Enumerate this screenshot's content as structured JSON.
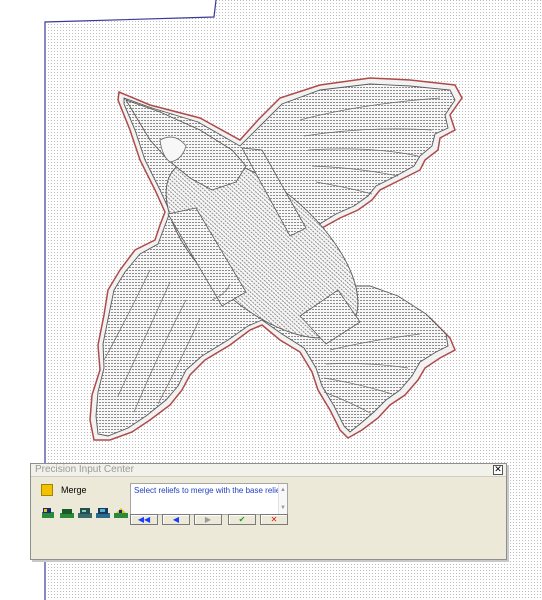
{
  "panel": {
    "title": "Precision Input Center",
    "close_glyph": "✕",
    "tool_name": "Merge",
    "tool_color": "#f2c200",
    "message": "Select reliefs to merge with the base relief",
    "toolbar_icons": [
      "relief-tool-1-icon",
      "relief-tool-2-icon",
      "relief-tool-3-icon",
      "relief-tool-4-icon",
      "relief-tool-5-icon"
    ],
    "nav_buttons": [
      {
        "name": "first-button",
        "glyph": "◀◀",
        "color": "#1a3cff"
      },
      {
        "name": "previous-button",
        "glyph": "◀",
        "color": "#1a3cff"
      },
      {
        "name": "next-button",
        "glyph": "▶",
        "color": "#9a9a9a"
      },
      {
        "name": "accept-button",
        "glyph": "✔",
        "color": "#1fa01f"
      },
      {
        "name": "cancel-button",
        "glyph": "✕",
        "color": "#e01010"
      }
    ]
  },
  "colors": {
    "workspace_border": "#3a3a9a",
    "bird_outline": "#b04a4a",
    "grid_dot": "#c8c8c8"
  }
}
